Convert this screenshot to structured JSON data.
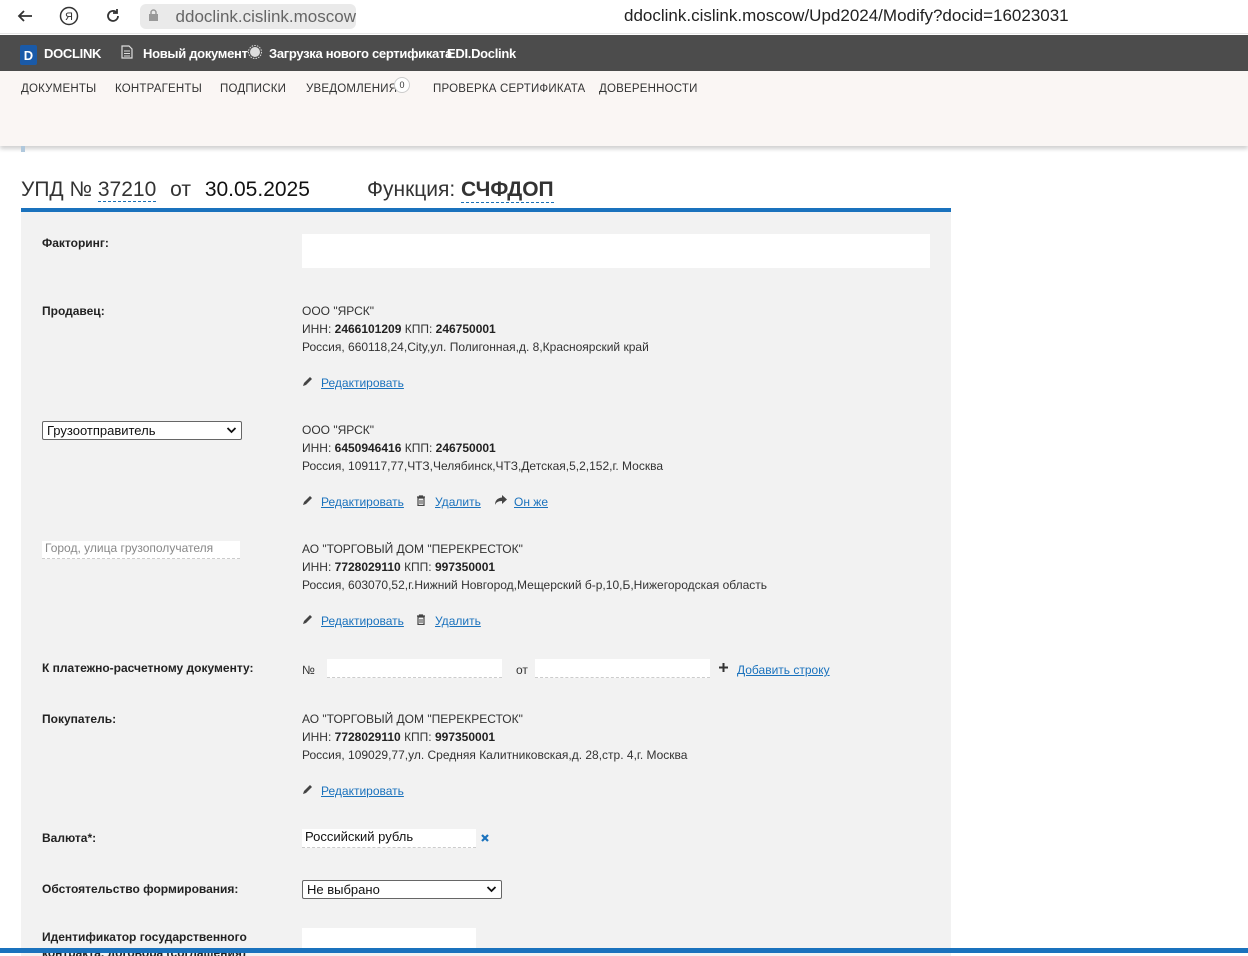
{
  "browser": {
    "domain": "ddoclink.cislink.moscow",
    "url": "ddoclink.cislink.moscow/Upd2024/Modify?docid=16023031"
  },
  "app_header": {
    "logo_letter": "D",
    "brand": "DOCLINK",
    "new_doc": "Новый документ",
    "upload_cert": "Загрузка нового сертификата",
    "edi": "EDI.Doclink"
  },
  "tabs": [
    {
      "label": "ДОКУМЕНТЫ"
    },
    {
      "label": "КОНТРАГЕНТЫ"
    },
    {
      "label": "ПОДПИСКИ"
    },
    {
      "label": "УВЕДОМЛЕНИЯ"
    },
    {
      "label": "ПРОВЕРКА СЕРТИФИКАТА"
    },
    {
      "label": "ДОВЕРЕННОСТИ"
    }
  ],
  "notifications_count": "0",
  "title": {
    "prefix": "УПД №",
    "number": "37210",
    "from": "от",
    "date": "30.05.2025",
    "function_label": "Функция:",
    "function_value": "СЧФДОП"
  },
  "form": {
    "factoring_label": "Факторинг:",
    "seller_label": "Продавец:",
    "seller": {
      "name": "ООО \"ЯРСК\"",
      "inn_label": "ИНН:",
      "inn": "2466101209",
      "kpp_label": "КПП:",
      "kpp": "246750001",
      "address": "Россия, 660118,24,City,ул. Полигонная,д. 8,Красноярский край"
    },
    "shipper_select": "Грузоотправитель",
    "shipper": {
      "name": "ООО \"ЯРСК\"",
      "inn_label": "ИНН:",
      "inn": "6450946416",
      "kpp_label": "КПП:",
      "kpp": "246750001",
      "address": "Россия, 109117,77,ЧТЗ,Челябинск,ЧТЗ,Детская,5,2,152,г. Москва"
    },
    "consignee_placeholder": "Город, улица грузополучателя",
    "consignee": {
      "name": "АО \"ТОРГОВЫЙ ДОМ \"ПЕРЕКРЕСТОК\"",
      "inn_label": "ИНН:",
      "inn": "7728029110",
      "kpp_label": "КПП:",
      "kpp": "997350001",
      "address": "Россия, 603070,52,г.Нижний Новгород,Мещерский б-р,10,Б,Нижегородская область"
    },
    "payment_doc_label": "К платежно-расчетному документу:",
    "payment_no_label": "№",
    "payment_from_label": "от",
    "add_row": "Добавить строку",
    "buyer_label": "Покупатель:",
    "buyer": {
      "name": "АО \"ТОРГОВЫЙ ДОМ \"ПЕРЕКРЕСТОК\"",
      "inn_label": "ИНН:",
      "inn": "7728029110",
      "kpp_label": "КПП:",
      "kpp": "997350001",
      "address": "Россия, 109029,77,ул. Средняя Калитниковская,д. 28,стр. 4,г. Москва"
    },
    "currency_label": "Валюта*:",
    "currency_value": "Российский рубль",
    "circumstance_label": "Обстоятельство формирования:",
    "circumstance_value": "Не выбрано",
    "gov_id_label": "Идентификатор государственного",
    "gov_id_label2": "контракта, договора (соглашения)"
  },
  "actions": {
    "edit": "Редактировать",
    "delete": "Удалить",
    "same": "Он же"
  },
  "colors": {
    "accent": "#1a72bd",
    "header_bg": "#4c4c4c",
    "nav_bg": "#faf6f4",
    "panel_bg": "#f2f2f2"
  }
}
